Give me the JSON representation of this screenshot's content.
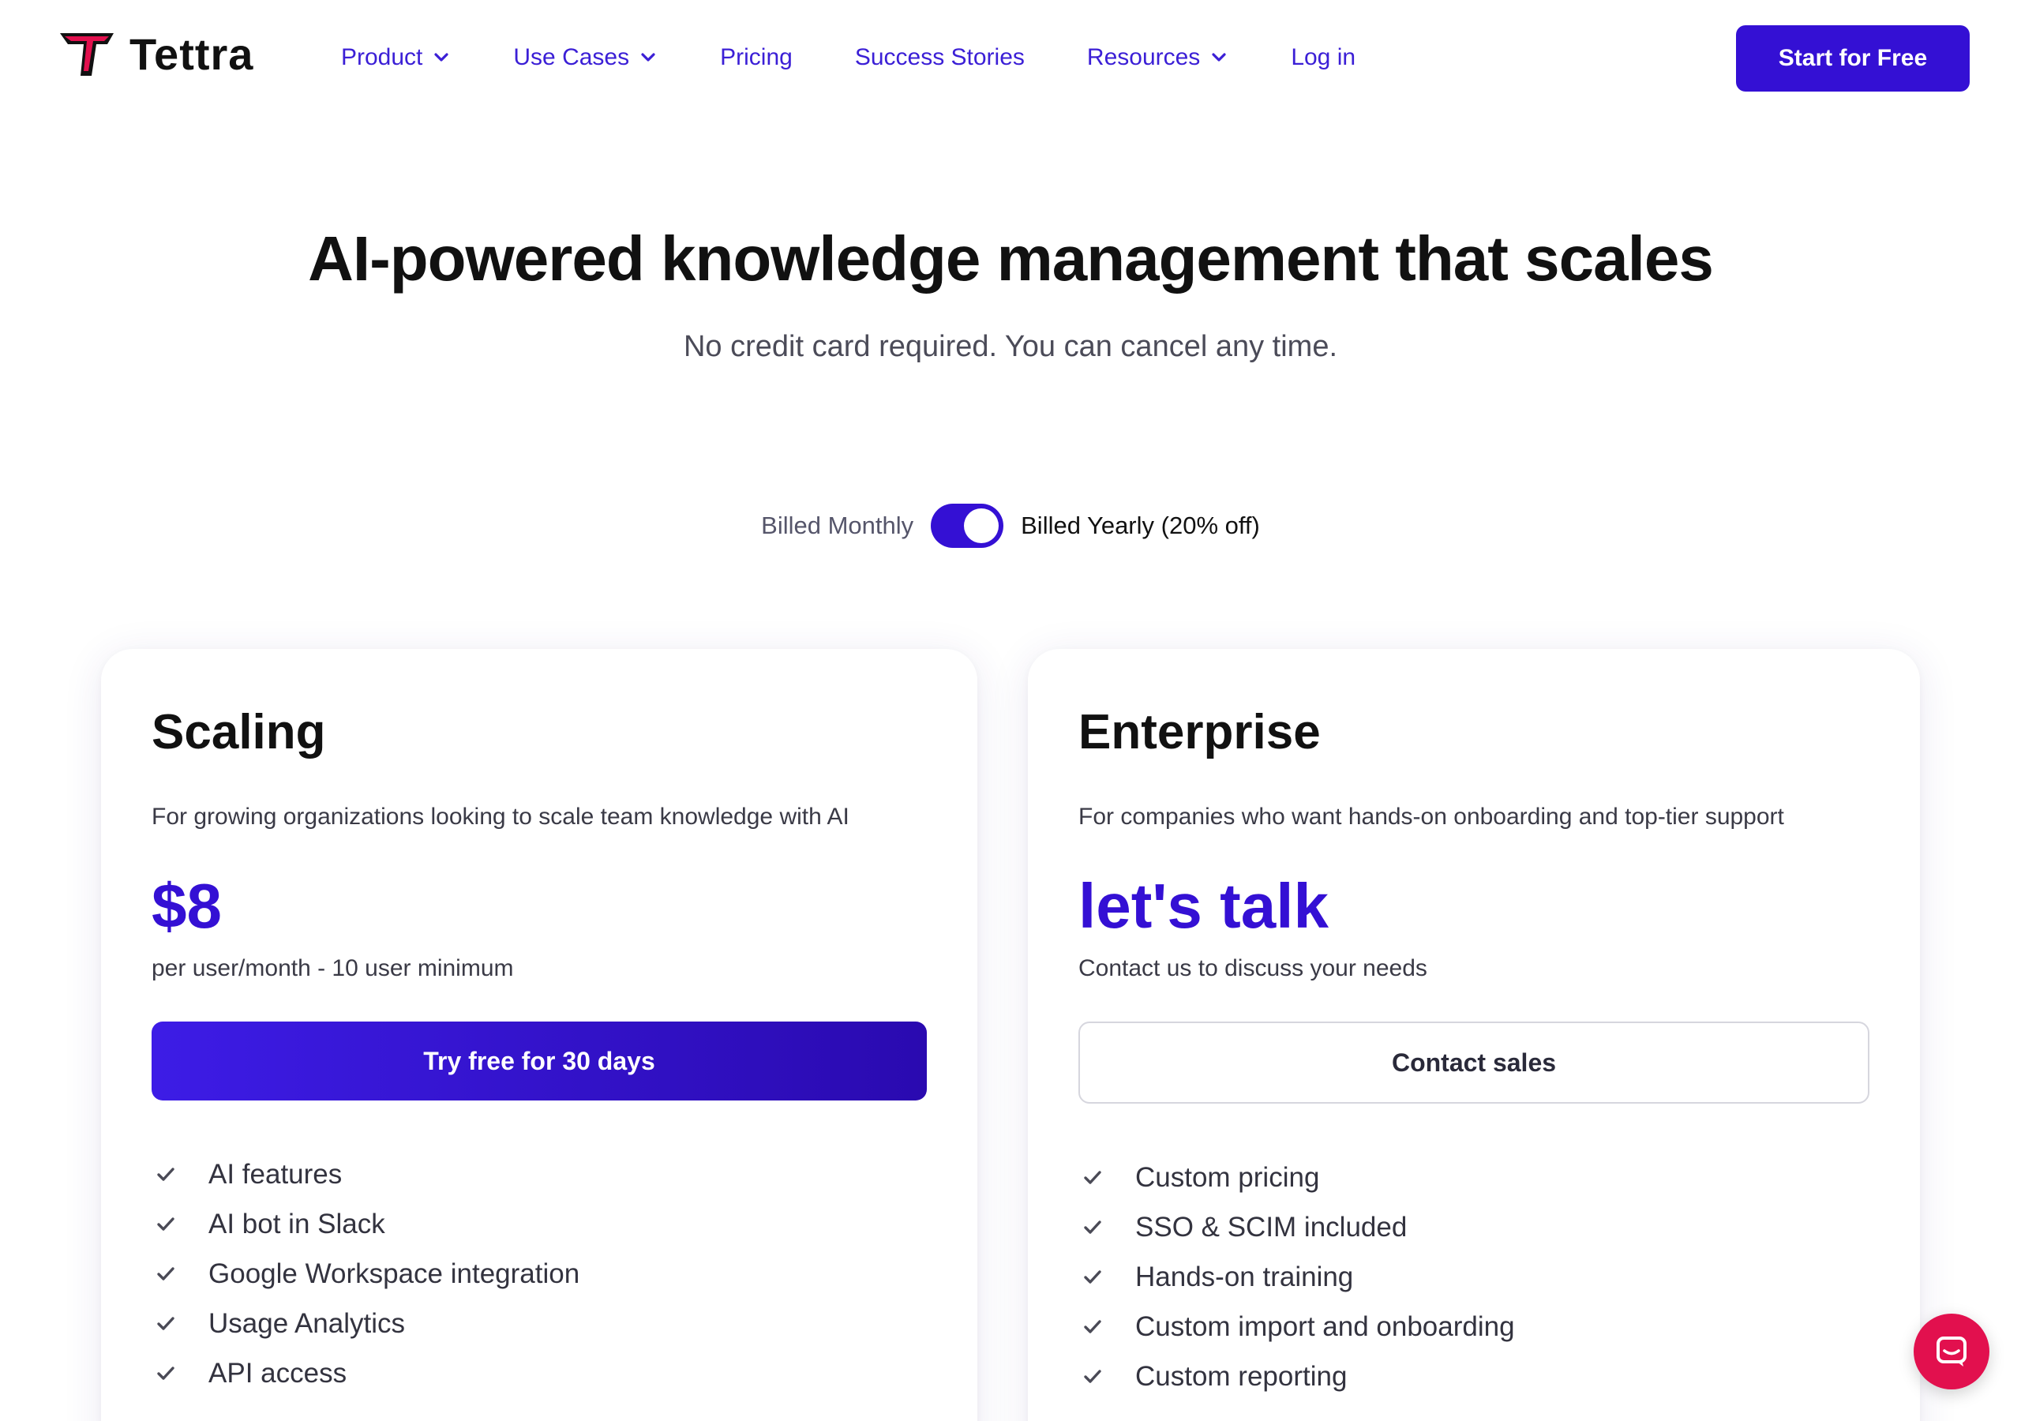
{
  "brand": {
    "name": "Tettra",
    "accent": "#3410d4",
    "logo_color": "#e2104e"
  },
  "nav": {
    "links": [
      {
        "label": "Product",
        "dropdown": true
      },
      {
        "label": "Use Cases",
        "dropdown": true
      },
      {
        "label": "Pricing",
        "dropdown": false
      },
      {
        "label": "Success Stories",
        "dropdown": false
      },
      {
        "label": "Resources",
        "dropdown": true
      },
      {
        "label": "Log in",
        "dropdown": false
      }
    ],
    "cta": "Start for Free"
  },
  "hero": {
    "title": "AI-powered knowledge management that scales",
    "subtitle": "No credit card required. You can cancel any time."
  },
  "billing": {
    "monthly_label": "Billed Monthly",
    "yearly_label": "Billed Yearly (20% off)",
    "selected": "yearly"
  },
  "plans": [
    {
      "name": "Scaling",
      "description": "For growing organizations looking to scale team knowledge with AI",
      "price": "$8",
      "price_note": "per user/month - 10 user minimum",
      "button": "Try free for 30 days",
      "features": [
        "AI features",
        "AI bot in Slack",
        "Google Workspace integration",
        "Usage Analytics",
        "API access"
      ]
    },
    {
      "name": "Enterprise",
      "description": "For companies who want hands-on onboarding and top-tier support",
      "price": "let's talk",
      "price_note": "Contact us to discuss your needs",
      "button": "Contact sales",
      "features": [
        "Custom pricing",
        "SSO & SCIM included",
        "Hands-on training",
        "Custom import and onboarding",
        "Custom reporting"
      ]
    }
  ],
  "icons": {
    "dropdown": "chevron-down-icon",
    "feature": "check-icon",
    "chat": "chat-icon"
  }
}
